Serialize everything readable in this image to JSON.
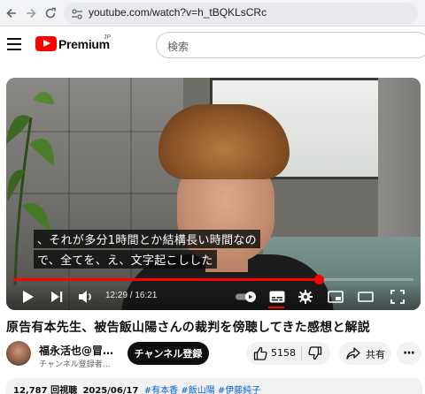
{
  "browser": {
    "url": "youtube.com/watch?v=h_tBQKLsCRc"
  },
  "header": {
    "logo_text": "Premium",
    "logo_region": "JP",
    "search_placeholder": "検索"
  },
  "player": {
    "captions": [
      "、それが多分1時間とか結構長い時間なの",
      "で、全てを、え、文字起こしした"
    ],
    "current_time": "12:29",
    "duration": "16:21",
    "time_display": "12:29 / 16:21",
    "progress_fraction": 0.763,
    "accent_color": "#ff0000"
  },
  "video": {
    "title": "原告有本先生、被告飯山陽さんの裁判を傍聴してきた感想と解説",
    "channel_name": "福永活也@冒…",
    "channel_sub": "チャンネル登録者…",
    "subscribe_label": "チャンネル登録",
    "likes": "5158",
    "share_label": "共有",
    "views": "12,787 回視聴",
    "date": "2025/06/17",
    "tags": [
      "#有本香",
      "#飯山陽",
      "#伊藤純子"
    ]
  }
}
